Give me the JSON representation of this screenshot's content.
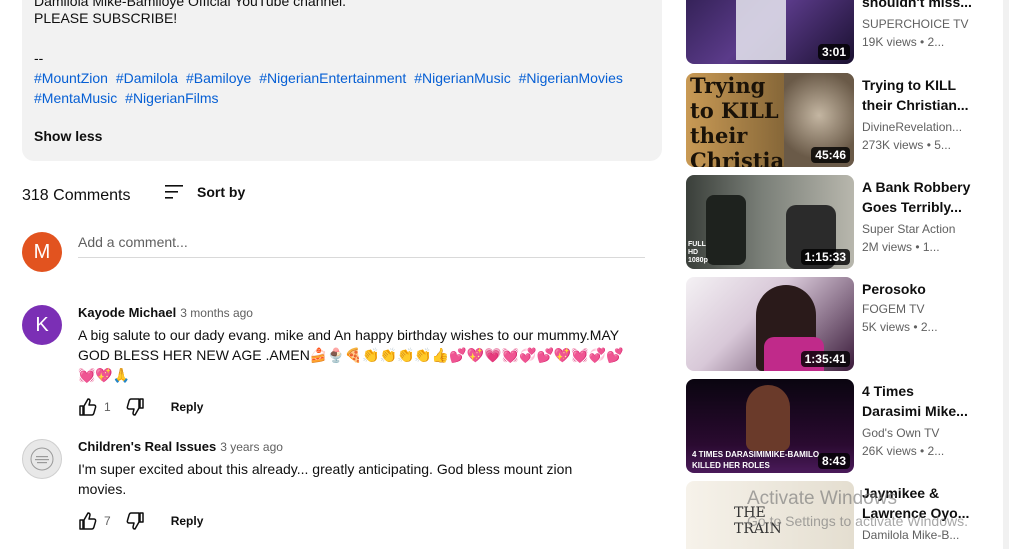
{
  "description": {
    "cut_line": "Damilola Mike-Bamiloye Official YouTube channel.",
    "subscribe": "PLEASE SUBSCRIBE!",
    "dash": "--",
    "tags_line1": [
      "#MountZion",
      "#Damilola",
      "#Bamiloye",
      "#NigerianEntertainment",
      "#NigerianMusic",
      "#NigerianMovies"
    ],
    "tags_line2": [
      "#MentaMusic",
      "#NigerianFilms"
    ],
    "show_less": "Show less"
  },
  "comments": {
    "count_label": "318 Comments",
    "sort_label": "Sort by",
    "add_avatar_letter": "M",
    "add_placeholder": "Add a comment...",
    "items": [
      {
        "avatar_letter": "K",
        "author": "Kayode Michael",
        "time": "3 months ago",
        "text": "A big salute to our dady evang. mike and An happy birthday wishes to our mummy.MAY GOD BLESS HER NEW AGE .AMEN🍰🍨🍕👏👏👏👏👍💕💖💗💓💞💕💖💓💞💕💓💖🙏",
        "likes": "1",
        "reply": "Reply"
      },
      {
        "avatar_letter": "",
        "author": "Children's Real Issues",
        "time": "3 years ago",
        "text": "I'm super excited about this already... greatly anticipating. God bless mount zion movies.",
        "likes": "7",
        "reply": "Reply"
      }
    ]
  },
  "recommendations": [
    {
      "title": "shouldn't miss...",
      "channel": "SUPERCHOICE TV",
      "meta": "19K views • 2...",
      "duration": "3:01"
    },
    {
      "title": "Trying to KILL their Christian...",
      "channel": "DivineRevelation...",
      "meta": "273K views • 5...",
      "duration": "45:46",
      "thumb_text": "Trying to KILL their Christian Son"
    },
    {
      "title": "A Bank Robbery Goes Terribly...",
      "channel": "Super Star Action",
      "meta": "2M views • 1...",
      "duration": "1:15:33",
      "badge": "FULL HD 1080p"
    },
    {
      "title": "Perosoko",
      "channel": "FOGEM TV",
      "meta": "5K views • 2...",
      "duration": "1:35:41"
    },
    {
      "title": "4 Times Darasimi Mike...",
      "channel": "God's Own TV",
      "meta": "26K views • 2...",
      "duration": "8:43",
      "thumb_text": "4 TIMES DARASIMIMIKE-BAMILO KILLED HER ROLES"
    },
    {
      "title": "Jaymikee & Lawrence Oyo...",
      "channel": "Damilola Mike-B...",
      "meta": "",
      "duration": "",
      "thumb_text": "THE TRAIN"
    }
  ],
  "watermark": {
    "line1": "Activate Windows",
    "line2": "Go to Settings to activate Windows."
  },
  "colors": {
    "link": "#065fd4",
    "description_bg": "#f2f2f2",
    "avatar_m": "#e2531f",
    "avatar_k": "#7b2fb5"
  }
}
